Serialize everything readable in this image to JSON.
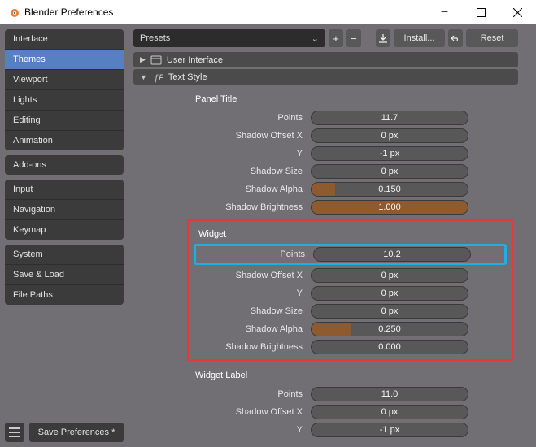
{
  "window": {
    "title": "Blender Preferences"
  },
  "sidebar": {
    "groups": [
      {
        "items": [
          "Interface",
          "Themes",
          "Viewport",
          "Lights",
          "Editing",
          "Animation"
        ],
        "active": 1
      },
      {
        "items": [
          "Add-ons"
        ]
      },
      {
        "items": [
          "Input",
          "Navigation",
          "Keymap"
        ]
      },
      {
        "items": [
          "System",
          "Save & Load",
          "File Paths"
        ]
      }
    ],
    "save": "Save Preferences *"
  },
  "toolbar": {
    "presets": "Presets",
    "install": "Install...",
    "reset": "Reset"
  },
  "panels": {
    "user_interface": "User Interface",
    "text_style": "Text Style"
  },
  "textstyle": {
    "panel_title": {
      "header": "Panel Title",
      "rows": [
        {
          "label": "Points",
          "value": "11.7",
          "fill": 0
        },
        {
          "label": "Shadow Offset X",
          "value": "0 px",
          "fill": 0
        },
        {
          "label": "Y",
          "value": "-1 px",
          "fill": 0
        },
        {
          "label": "Shadow Size",
          "value": "0 px",
          "fill": 0
        },
        {
          "label": "Shadow Alpha",
          "value": "0.150",
          "fill": 15
        },
        {
          "label": "Shadow Brightness",
          "value": "1.000",
          "fill": 100
        }
      ]
    },
    "widget": {
      "header": "Widget",
      "rows": [
        {
          "label": "Points",
          "value": "10.2",
          "fill": 0
        },
        {
          "label": "Shadow Offset X",
          "value": "0 px",
          "fill": 0
        },
        {
          "label": "Y",
          "value": "0 px",
          "fill": 0
        },
        {
          "label": "Shadow Size",
          "value": "0 px",
          "fill": 0
        },
        {
          "label": "Shadow Alpha",
          "value": "0.250",
          "fill": 25
        },
        {
          "label": "Shadow Brightness",
          "value": "0.000",
          "fill": 0
        }
      ]
    },
    "widget_label": {
      "header": "Widget Label",
      "rows": [
        {
          "label": "Points",
          "value": "11.0",
          "fill": 0
        },
        {
          "label": "Shadow Offset X",
          "value": "0 px",
          "fill": 0
        },
        {
          "label": "Y",
          "value": "-1 px",
          "fill": 0
        }
      ]
    }
  }
}
